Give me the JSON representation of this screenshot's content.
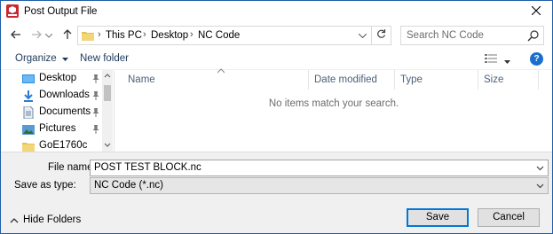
{
  "window": {
    "title": "Post Output File"
  },
  "address": {
    "crumbs": [
      "This PC",
      "Desktop",
      "NC Code"
    ]
  },
  "search": {
    "placeholder": "Search NC Code"
  },
  "toolbar": {
    "organize_label": "Organize",
    "new_folder_label": "New folder",
    "help_label": "?"
  },
  "nav": {
    "items": [
      {
        "label": "Desktop",
        "icon": "desktop-folder-icon",
        "pinned": true
      },
      {
        "label": "Downloads",
        "icon": "downloads-icon",
        "pinned": true
      },
      {
        "label": "Documents",
        "icon": "documents-icon",
        "pinned": true
      },
      {
        "label": "Pictures",
        "icon": "pictures-icon",
        "pinned": true
      },
      {
        "label": "GoE1760c",
        "icon": "folder-icon",
        "pinned": false
      }
    ]
  },
  "columns": [
    "Name",
    "Date modified",
    "Type",
    "Size"
  ],
  "empty_message": "No items match your search.",
  "form": {
    "file_name_label": "File name:",
    "file_name_value": "POST TEST BLOCK.nc",
    "save_type_label": "Save as type:",
    "save_type_value": "NC Code (*.nc)"
  },
  "footer": {
    "hide_folders_label": "Hide Folders",
    "save_label": "Save",
    "cancel_label": "Cancel"
  },
  "colors": {
    "accent": "#0078d7",
    "help": "#1a6fcf",
    "folder": "#e8c152"
  }
}
